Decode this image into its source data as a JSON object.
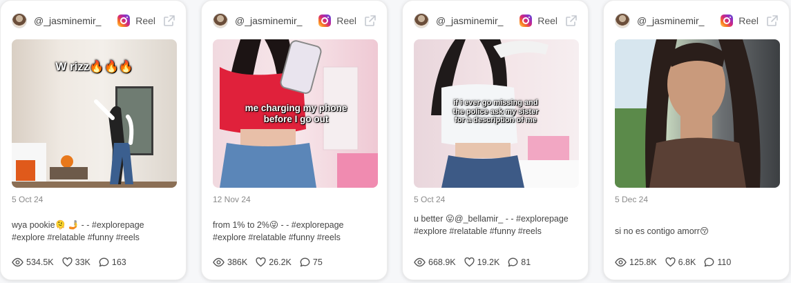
{
  "cards": [
    {
      "username": "@_jasminemir_",
      "type_label": "Reel",
      "overlay_text": "W rizz🔥🔥🔥",
      "date": "5 Oct 24",
      "caption": "wya pookie🫠 🤳 - - #explorepage #explore #relatable #funny #reels",
      "views": "534.5K",
      "likes": "33K",
      "comments": "163"
    },
    {
      "username": "@_jasminemir_",
      "type_label": "Reel",
      "overlay_text": "me charging my phone before I go out",
      "date": "12 Nov 24",
      "caption": "from 1% to 2%😜 - - #explorepage #explore #relatable #funny #reels",
      "views": "386K",
      "likes": "26.2K",
      "comments": "75"
    },
    {
      "username": "@_jasminemir_",
      "type_label": "Reel",
      "overlay_text": "if i ever go missing and the police ask my sister for a description of me",
      "date": "5 Oct 24",
      "caption": "u better 😛@_bellamir_ - - #explorepage #explore #relatable #funny #reels",
      "views": "668.9K",
      "likes": "19.2K",
      "comments": "81"
    },
    {
      "username": "@_jasminemir_",
      "type_label": "Reel",
      "overlay_text": "",
      "date": "5 Dec 24",
      "caption": "si no es contigo amorr😚",
      "views": "125.8K",
      "likes": "6.8K",
      "comments": "110"
    }
  ],
  "icons": {
    "platform": "instagram-icon",
    "external": "external-link-icon",
    "views": "eye-icon",
    "likes": "heart-icon",
    "comments": "comment-icon"
  }
}
